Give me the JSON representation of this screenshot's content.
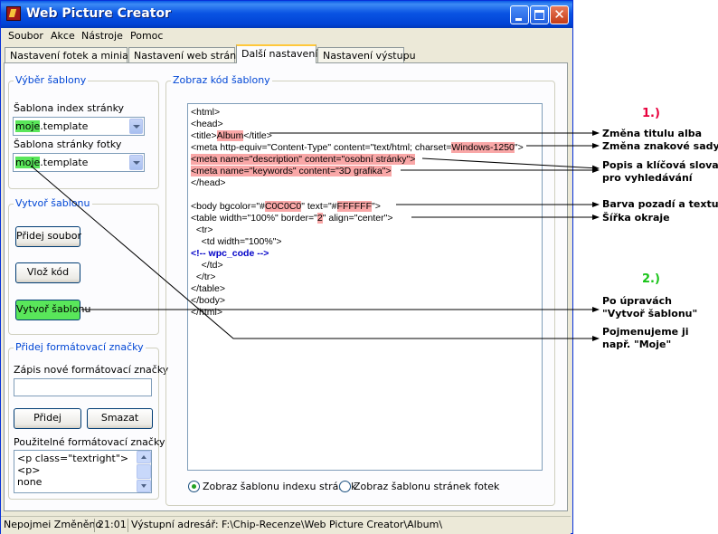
{
  "window": {
    "title": "Web Picture Creator"
  },
  "menu": {
    "items": [
      {
        "label": "Soubor"
      },
      {
        "label": "Akce"
      },
      {
        "label": "Nástroje"
      },
      {
        "label": "Pomoc"
      }
    ]
  },
  "tabs": [
    {
      "label": "Nastavení fotek a miniatur"
    },
    {
      "label": "Nastavení web stránek"
    },
    {
      "label": "Další nastavení"
    },
    {
      "label": "Nastavení výstupu"
    }
  ],
  "templates_group": {
    "title": "Výběr šablony",
    "index_label": "Šablona index stránky",
    "index_value_hl": "moje",
    "index_value_rest": ".template",
    "photo_label": "Šablona stránky fotky",
    "photo_value_hl": "moje",
    "photo_value_rest": ".template"
  },
  "create_group": {
    "title": "Vytvoř šablonu",
    "add_file": "Přidej soubor",
    "insert_code": "Vlož kód",
    "create_template": "Vytvoř šablonu"
  },
  "marks_group": {
    "title": "Přidej formátovací značky",
    "new_label": "Zápis nové formátovací značky",
    "new_value": "",
    "add": "Přidej",
    "delete": "Smazat",
    "used_label": "Použitelné formátovací značky",
    "items": [
      "<p class=\"textright\">",
      "<p>",
      "none"
    ]
  },
  "code_group": {
    "title": "Zobraz kód šablony",
    "lines": {
      "l1": "<html>",
      "l2": "<head>",
      "l3a": "<title>",
      "l3b": "Album",
      "l3c": "</title>",
      "l4a": "<meta http-equiv=\"Content-Type\" content=\"text/html; charset=",
      "l4b": "Windows-1250",
      "l4c": "\">",
      "l5": "<meta name=\"description\" content=\"osobní stránky\">",
      "l6": "<meta name=\"keywords\" content=\"3D grafika\">",
      "l7": "</head>",
      "l8a": "<body bgcolor=\"#",
      "l8b": "C0C0C0",
      "l8c": "\" text=\"#",
      "l8d": "FFFFFF",
      "l8e": "\">",
      "l9a": "<table width=\"100%\" border=\"",
      "l9b": "2",
      "l9c": "\" align=\"center\">",
      "l10": "  <tr>",
      "l11": "    <td width=\"100%\">",
      "l12": "<!-- wpc_code -->",
      "l13": "    </td>",
      "l14": "  </tr>",
      "l15": "</table>",
      "l16": "</body>",
      "l17": "</html>"
    },
    "radio_index": "Zobraz šablonu indexu stránek",
    "radio_photo": "Zobraz šablonu stránek fotek",
    "radio_selected": "index"
  },
  "status": {
    "p1": "Nepojmei Změněno",
    "p2": "21:01",
    "p3": "Výstupní adresář: F:\\Chip-Recenze\\Web Picture Creator\\Album\\"
  },
  "annotations": {
    "step1": "1.)",
    "a1": "Změna titulu alba",
    "a2": "Změna znakové sady",
    "a3a": "Popis a klíčová slova",
    "a3b": "pro vyhledávání",
    "a4": "Barva pozadí a textu",
    "a5": "Šířka okraje",
    "step2": "2.)",
    "b1a": "Po úpravách",
    "b1b": "\"Vytvoř šablonu\"",
    "b2a": "Pojmenujeme ji",
    "b2b": "např. \"Moje\""
  },
  "colors": {
    "step1": "#e8003d",
    "step2": "#19c419",
    "highlight_green": "#59e65a",
    "highlight_red": "#f9a7a7"
  }
}
